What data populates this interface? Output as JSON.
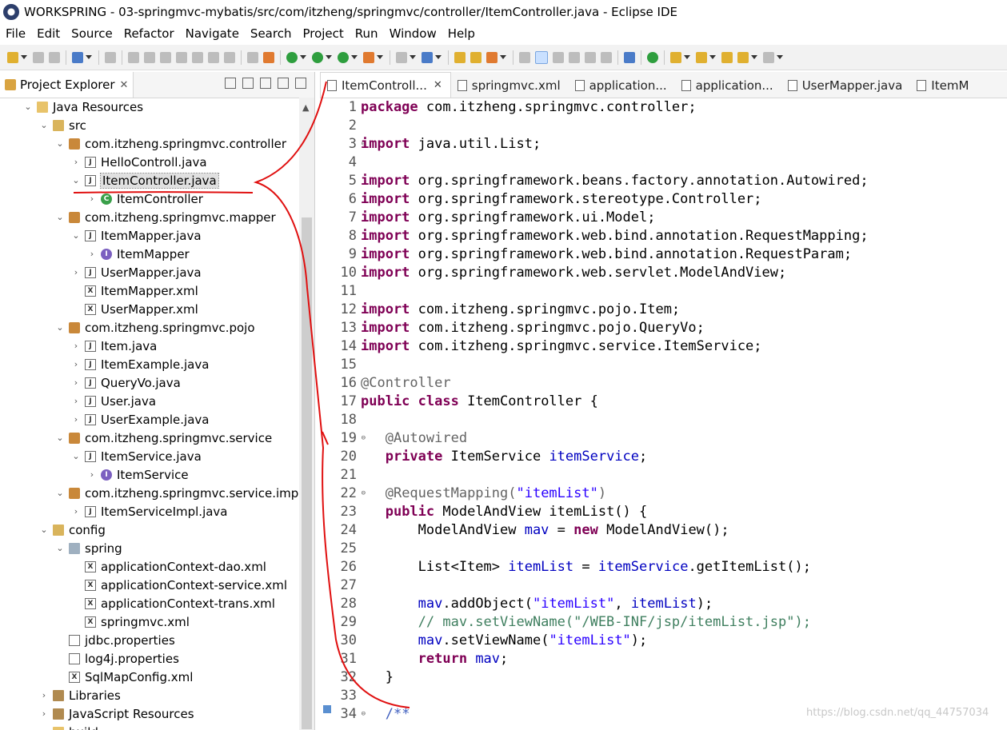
{
  "window": {
    "title": "WORKSPRING - 03-springmvc-mybatis/src/com/itzheng/springmvc/controller/ItemController.java - Eclipse IDE"
  },
  "menu": [
    "File",
    "Edit",
    "Source",
    "Refactor",
    "Navigate",
    "Search",
    "Project",
    "Run",
    "Window",
    "Help"
  ],
  "project_explorer": {
    "tab_label": "Project Explorer",
    "tree": [
      {
        "label": "Java Resources",
        "twisty": "⌄",
        "icon": "folder"
      },
      {
        "label": "src",
        "twisty": "⌄",
        "icon": "srcf"
      },
      {
        "label": "com.itzheng.springmvc.controller",
        "twisty": "⌄",
        "icon": "pkg"
      },
      {
        "label": "HelloControll.java",
        "twisty": "›",
        "icon": "file"
      },
      {
        "label": "ItemController.java",
        "twisty": "⌄",
        "icon": "file",
        "selected": true
      },
      {
        "label": "ItemController",
        "twisty": "›",
        "icon": "cls"
      },
      {
        "label": "com.itzheng.springmvc.mapper",
        "twisty": "⌄",
        "icon": "pkg"
      },
      {
        "label": "ItemMapper.java",
        "twisty": "⌄",
        "icon": "file"
      },
      {
        "label": "ItemMapper",
        "twisty": "›",
        "icon": "intf"
      },
      {
        "label": "UserMapper.java",
        "twisty": "›",
        "icon": "file"
      },
      {
        "label": "ItemMapper.xml",
        "twisty": "",
        "icon": "xml"
      },
      {
        "label": "UserMapper.xml",
        "twisty": "",
        "icon": "xml"
      },
      {
        "label": "com.itzheng.springmvc.pojo",
        "twisty": "⌄",
        "icon": "pkg"
      },
      {
        "label": "Item.java",
        "twisty": "›",
        "icon": "file"
      },
      {
        "label": "ItemExample.java",
        "twisty": "›",
        "icon": "file"
      },
      {
        "label": "QueryVo.java",
        "twisty": "›",
        "icon": "file"
      },
      {
        "label": "User.java",
        "twisty": "›",
        "icon": "file"
      },
      {
        "label": "UserExample.java",
        "twisty": "›",
        "icon": "file"
      },
      {
        "label": "com.itzheng.springmvc.service",
        "twisty": "⌄",
        "icon": "pkg"
      },
      {
        "label": "ItemService.java",
        "twisty": "⌄",
        "icon": "file"
      },
      {
        "label": "ItemService",
        "twisty": "›",
        "icon": "intf"
      },
      {
        "label": "com.itzheng.springmvc.service.impl",
        "twisty": "⌄",
        "icon": "pkg"
      },
      {
        "label": "ItemServiceImpl.java",
        "twisty": "›",
        "icon": "file"
      },
      {
        "label": "config",
        "twisty": "⌄",
        "icon": "srcf"
      },
      {
        "label": "spring",
        "twisty": "⌄",
        "icon": "spring"
      },
      {
        "label": "applicationContext-dao.xml",
        "twisty": "",
        "icon": "xml"
      },
      {
        "label": "applicationContext-service.xml",
        "twisty": "",
        "icon": "xml"
      },
      {
        "label": "applicationContext-trans.xml",
        "twisty": "",
        "icon": "xml"
      },
      {
        "label": "springmvc.xml",
        "twisty": "",
        "icon": "xml"
      },
      {
        "label": "jdbc.properties",
        "twisty": "",
        "icon": "props"
      },
      {
        "label": "log4j.properties",
        "twisty": "",
        "icon": "props"
      },
      {
        "label": "SqlMapConfig.xml",
        "twisty": "",
        "icon": "xml"
      },
      {
        "label": "Libraries",
        "twisty": "›",
        "icon": "lib"
      },
      {
        "label": "JavaScript Resources",
        "twisty": "›",
        "icon": "lib"
      },
      {
        "label": "build",
        "twisty": "›",
        "icon": "folder"
      }
    ]
  },
  "editor": {
    "tabs": [
      {
        "label": "ItemControll...",
        "active": true
      },
      {
        "label": "springmvc.xml"
      },
      {
        "label": "application..."
      },
      {
        "label": "application..."
      },
      {
        "label": "UserMapper.java"
      },
      {
        "label": "ItemM"
      }
    ],
    "lines": [
      {
        "n": "1",
        "t": [
          [
            "kw",
            "package"
          ],
          [
            "",
            "com.itzheng.springmvc.controller;"
          ]
        ]
      },
      {
        "n": "2",
        "t": []
      },
      {
        "n": "3",
        "fold": true,
        "t": [
          [
            "kw",
            "import"
          ],
          [
            "",
            "java.util.List;"
          ]
        ]
      },
      {
        "n": "4",
        "t": []
      },
      {
        "n": "5",
        "t": [
          [
            "kw",
            "import"
          ],
          [
            "",
            "org.springframework.beans.factory.annotation.Autowired;"
          ]
        ]
      },
      {
        "n": "6",
        "t": [
          [
            "kw",
            "import"
          ],
          [
            "",
            "org.springframework.stereotype.Controller;"
          ]
        ]
      },
      {
        "n": "7",
        "t": [
          [
            "kw",
            "import"
          ],
          [
            "",
            "org.springframework.ui.Model;"
          ]
        ]
      },
      {
        "n": "8",
        "t": [
          [
            "kw",
            "import"
          ],
          [
            "",
            "org.springframework.web.bind.annotation.RequestMapping;"
          ]
        ]
      },
      {
        "n": "9",
        "t": [
          [
            "kw",
            "import"
          ],
          [
            "",
            "org.springframework.web.bind.annotation.RequestParam;"
          ]
        ]
      },
      {
        "n": "10",
        "t": [
          [
            "kw",
            "import"
          ],
          [
            "",
            "org.springframework.web.servlet.ModelAndView;"
          ]
        ]
      },
      {
        "n": "11",
        "t": []
      },
      {
        "n": "12",
        "t": [
          [
            "kw",
            "import"
          ],
          [
            "",
            "com.itzheng.springmvc.pojo.Item;"
          ]
        ]
      },
      {
        "n": "13",
        "t": [
          [
            "kw",
            "import"
          ],
          [
            "",
            "com.itzheng.springmvc.pojo.QueryVo;"
          ]
        ]
      },
      {
        "n": "14",
        "t": [
          [
            "kw",
            "import"
          ],
          [
            "",
            "com.itzheng.springmvc.service.ItemService;"
          ]
        ]
      },
      {
        "n": "15",
        "t": []
      },
      {
        "n": "16",
        "t": [
          [
            "ann",
            "@Controller"
          ]
        ]
      },
      {
        "n": "17",
        "t": [
          [
            "kw",
            "public"
          ],
          [
            "kw",
            "class"
          ],
          [
            "",
            "ItemController {"
          ]
        ]
      },
      {
        "n": "18",
        "t": []
      },
      {
        "n": "19",
        "fold": true,
        "t": [
          [
            "",
            "   "
          ],
          [
            "ann",
            "@Autowired"
          ]
        ]
      },
      {
        "n": "20",
        "t": [
          [
            "",
            "   "
          ],
          [
            "kw",
            "private"
          ],
          [
            "",
            "ItemService"
          ],
          [
            "fld",
            "itemService"
          ],
          [
            "",
            "\b;"
          ]
        ]
      },
      {
        "n": "21",
        "t": []
      },
      {
        "n": "22",
        "fold": true,
        "t": [
          [
            "",
            "   "
          ],
          [
            "ann",
            "@RequestMapping("
          ],
          [
            "str",
            "\"itemList\""
          ],
          [
            "ann",
            ")"
          ]
        ]
      },
      {
        "n": "23",
        "t": [
          [
            "",
            "   "
          ],
          [
            "kw",
            "public"
          ],
          [
            "",
            "ModelAndView itemList() {"
          ]
        ]
      },
      {
        "n": "24",
        "t": [
          [
            "",
            "       ModelAndView"
          ],
          [
            "fld",
            "mav"
          ],
          [
            "",
            "="
          ],
          [
            "kw",
            "new"
          ],
          [
            "",
            "ModelAndView();"
          ]
        ]
      },
      {
        "n": "25",
        "t": []
      },
      {
        "n": "26",
        "t": [
          [
            "",
            "       List<Item>"
          ],
          [
            "fld",
            "itemList"
          ],
          [
            "",
            "="
          ],
          [
            "fld",
            "itemService"
          ],
          [
            "",
            ".getItemList();"
          ]
        ]
      },
      {
        "n": "27",
        "t": []
      },
      {
        "n": "28",
        "t": [
          [
            "",
            "       "
          ],
          [
            "fld",
            "mav"
          ],
          [
            "",
            ".addObject("
          ],
          [
            "str",
            "\"itemList\""
          ],
          [
            "",
            ","
          ],
          [
            "fld",
            "itemList"
          ],
          [
            "",
            ");"
          ]
        ]
      },
      {
        "n": "29",
        "t": [
          [
            "",
            "       "
          ],
          [
            "cmt",
            "// mav.setViewName(\"/WEB-INF/jsp/itemList.jsp\");"
          ]
        ]
      },
      {
        "n": "30",
        "t": [
          [
            "",
            "       "
          ],
          [
            "fld",
            "mav"
          ],
          [
            "",
            ".setViewName("
          ],
          [
            "str",
            "\"itemList\""
          ],
          [
            "",
            ");"
          ]
        ]
      },
      {
        "n": "31",
        "t": [
          [
            "",
            "       "
          ],
          [
            "kw",
            "return"
          ],
          [
            "fld",
            "mav"
          ],
          [
            "",
            ";"
          ]
        ]
      },
      {
        "n": "32",
        "t": [
          [
            "",
            "   }"
          ]
        ]
      },
      {
        "n": "33",
        "t": []
      },
      {
        "n": "34",
        "fold": true,
        "t": [
          [
            "",
            "   "
          ],
          [
            "jd",
            "/**"
          ]
        ]
      }
    ]
  },
  "watermark": "https://blog.csdn.net/qq_44757034",
  "colors": {
    "keyword": "#7f0055",
    "annotation": "#646464",
    "string": "#2a00ff",
    "field": "#0000c0",
    "comment": "#3f7f5f",
    "annotation_stroke": "#e01010"
  }
}
